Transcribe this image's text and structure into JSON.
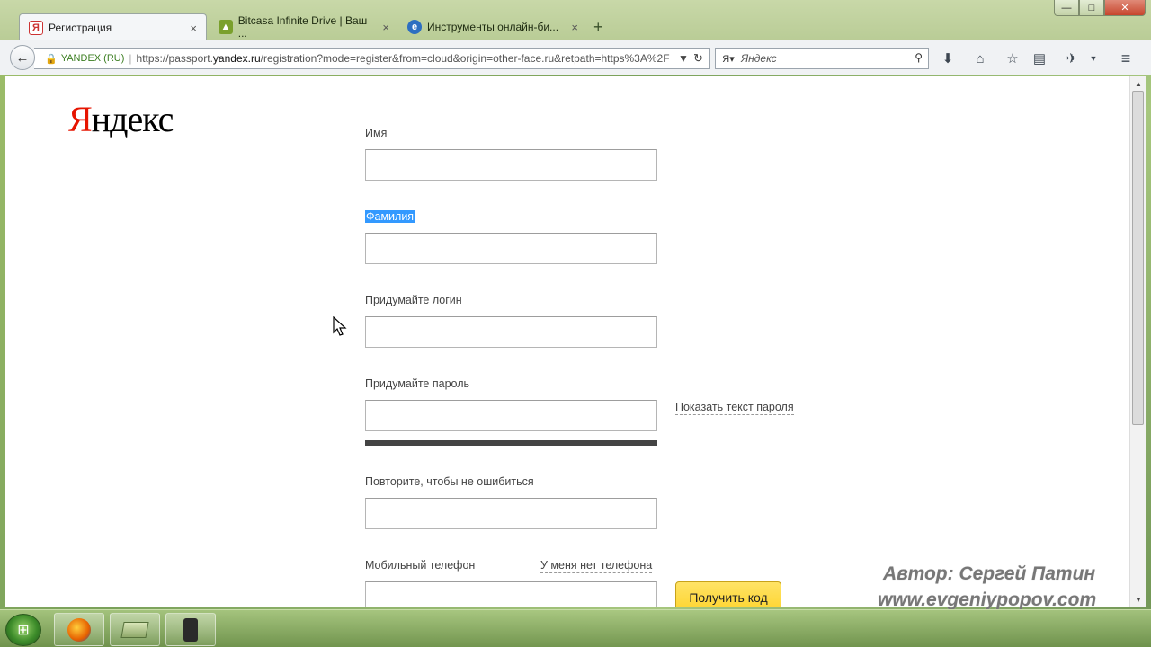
{
  "tabs": [
    {
      "label": "Регистрация",
      "icon": "yandex-favicon",
      "active": true
    },
    {
      "label": "Bitcasa Infinite Drive | Ваш ...",
      "icon": "bitcasa-favicon",
      "active": false
    },
    {
      "label": "Инструменты онлайн-би...",
      "icon": "ie-favicon",
      "active": false
    }
  ],
  "tab_close": "×",
  "new_tab": "+",
  "window_controls": {
    "minimize": "—",
    "maximize": "□",
    "close": "✕"
  },
  "address": {
    "identity": "YANDEX (RU)",
    "url_prefix": "https://passport.",
    "url_domain": "yandex.ru",
    "url_suffix": "/registration?mode=register&from=cloud&origin=other-face.ru&retpath=https%3A%2F"
  },
  "search": {
    "placeholder": "Яндекс"
  },
  "logo": {
    "first": "Я",
    "rest": "ндекс"
  },
  "form": {
    "first_name_label": "Имя",
    "last_name_label": "Фамилия",
    "login_label": "Придумайте логин",
    "password_label": "Придумайте пароль",
    "show_password": "Показать текст пароля",
    "repeat_label": "Повторите, чтобы не ошибиться",
    "phone_label": "Мобильный телефон",
    "no_phone": "У меня нет телефона",
    "get_code": "Получить код"
  },
  "watermark": {
    "author": "Автор: Сергей Патин",
    "site": "www.evgeniypopov.com"
  },
  "colors": {
    "yandex_red": "#e61400",
    "button_yellow": "#fdd42c",
    "selection": "#3399ff"
  }
}
